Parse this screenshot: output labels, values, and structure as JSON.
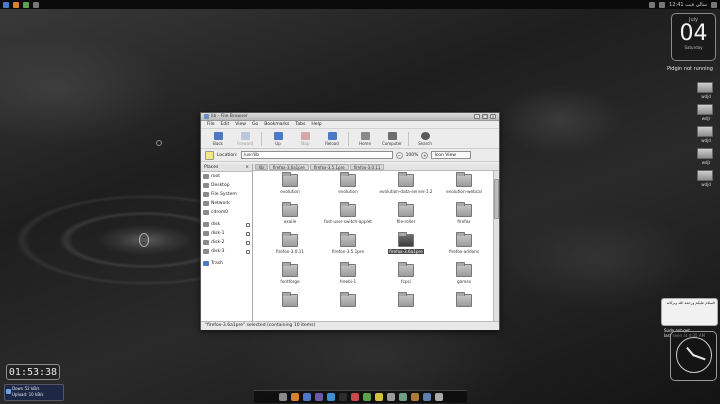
{
  "top_panel": {
    "right_text": "سالی فیت 12:41",
    "time": "12:41"
  },
  "clock_widget": {
    "month": "July",
    "day": "04",
    "weekday": "Saturday"
  },
  "pidgin_note": "Pidgin not running",
  "side_icons": [
    "wdjd",
    "wdjr",
    "wdjd",
    "wdjr",
    "wdjd"
  ],
  "chat": {
    "message": "السلام عليكم ورحمة الله وبركاته",
    "status_name": "Sudo apt-get",
    "status_time": "last seen at 4:35 AM"
  },
  "digital_clock": "01:53:38",
  "net": {
    "down": "Down 52 kB/s",
    "up": "Upload: 10 kB/s"
  },
  "window": {
    "title": "lib - File Browser",
    "menu": [
      "File",
      "Edit",
      "View",
      "Go",
      "Bookmarks",
      "Tabs",
      "Help"
    ],
    "toolbar": {
      "back": "Back",
      "forward": "Forward",
      "up": "Up",
      "stop": "Stop",
      "reload": "Reload",
      "home": "Home",
      "computer": "Computer",
      "search": "Search"
    },
    "location_label": "Location:",
    "location_value": "/usr/lib",
    "zoom": "100%",
    "view_mode": "Icon View",
    "places_header": "Places",
    "places": [
      {
        "label": "root",
        "eject": false
      },
      {
        "label": "Desktop",
        "eject": false
      },
      {
        "label": "File System",
        "eject": false
      },
      {
        "label": "Network",
        "eject": false
      },
      {
        "label": "cdrom0",
        "eject": false
      },
      {
        "label": "disk",
        "eject": true
      },
      {
        "label": "disk-1",
        "eject": true
      },
      {
        "label": "disk-2",
        "eject": true
      },
      {
        "label": "disk-3",
        "eject": true
      },
      {
        "label": "Trash",
        "eject": false
      }
    ],
    "path_crumbs": [
      "lib",
      "firefox-3.6a1pre",
      "firefox-3.5.1pre",
      "firefox-3.0.11"
    ],
    "files": [
      {
        "name": "evolution",
        "selected": false
      },
      {
        "name": "evolution",
        "selected": false
      },
      {
        "name": "evolution-data-server-1.2",
        "selected": false
      },
      {
        "name": "evolution-webcal",
        "selected": false
      },
      {
        "name": "exaile",
        "selected": false
      },
      {
        "name": "fast-user-switch-applet",
        "selected": false
      },
      {
        "name": "file-roller",
        "selected": false
      },
      {
        "name": "firefox",
        "selected": false
      },
      {
        "name": "firefox-3.0.11",
        "selected": false
      },
      {
        "name": "firefox-3.5.1pre",
        "selected": false
      },
      {
        "name": "firefox-3.6a1pre",
        "selected": true
      },
      {
        "name": "firefox-addons",
        "selected": false
      },
      {
        "name": "fontforge",
        "selected": false
      },
      {
        "name": "freebi-1",
        "selected": false
      },
      {
        "name": "fcpsi",
        "selected": false
      },
      {
        "name": "games",
        "selected": false
      },
      {
        "name": "",
        "selected": false
      },
      {
        "name": "",
        "selected": false
      },
      {
        "name": "",
        "selected": false
      },
      {
        "name": "",
        "selected": false
      }
    ],
    "status": "\"firefox-3.6a1pre\" selected (containing 10 items)"
  },
  "colors": {
    "accent": "#4b79c6",
    "selection": "#4a4a4a"
  }
}
